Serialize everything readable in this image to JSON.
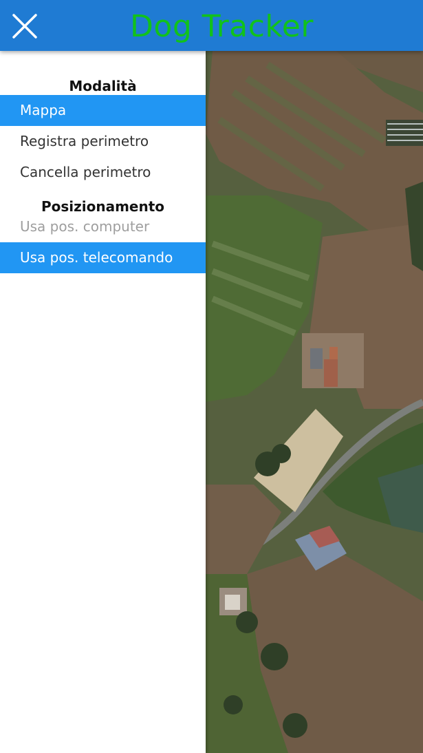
{
  "app": {
    "title": "Dog Tracker",
    "title_color": "#11c21b",
    "bar_color": "#1f7bd3",
    "close_icon": "close-icon"
  },
  "drawer": {
    "modalita": {
      "title": "Modalità",
      "items": [
        {
          "label": "Mappa",
          "state": "selected"
        },
        {
          "label": "Registra perimetro",
          "state": "normal"
        },
        {
          "label": "Cancella perimetro",
          "state": "normal"
        }
      ]
    },
    "posizionamento": {
      "title": "Posizionamento",
      "items": [
        {
          "label": "Usa pos. computer",
          "state": "disabled"
        },
        {
          "label": "Usa pos. telecomando",
          "state": "selected"
        }
      ]
    },
    "selected_color": "#2196f3"
  },
  "map": {
    "type": "satellite"
  }
}
